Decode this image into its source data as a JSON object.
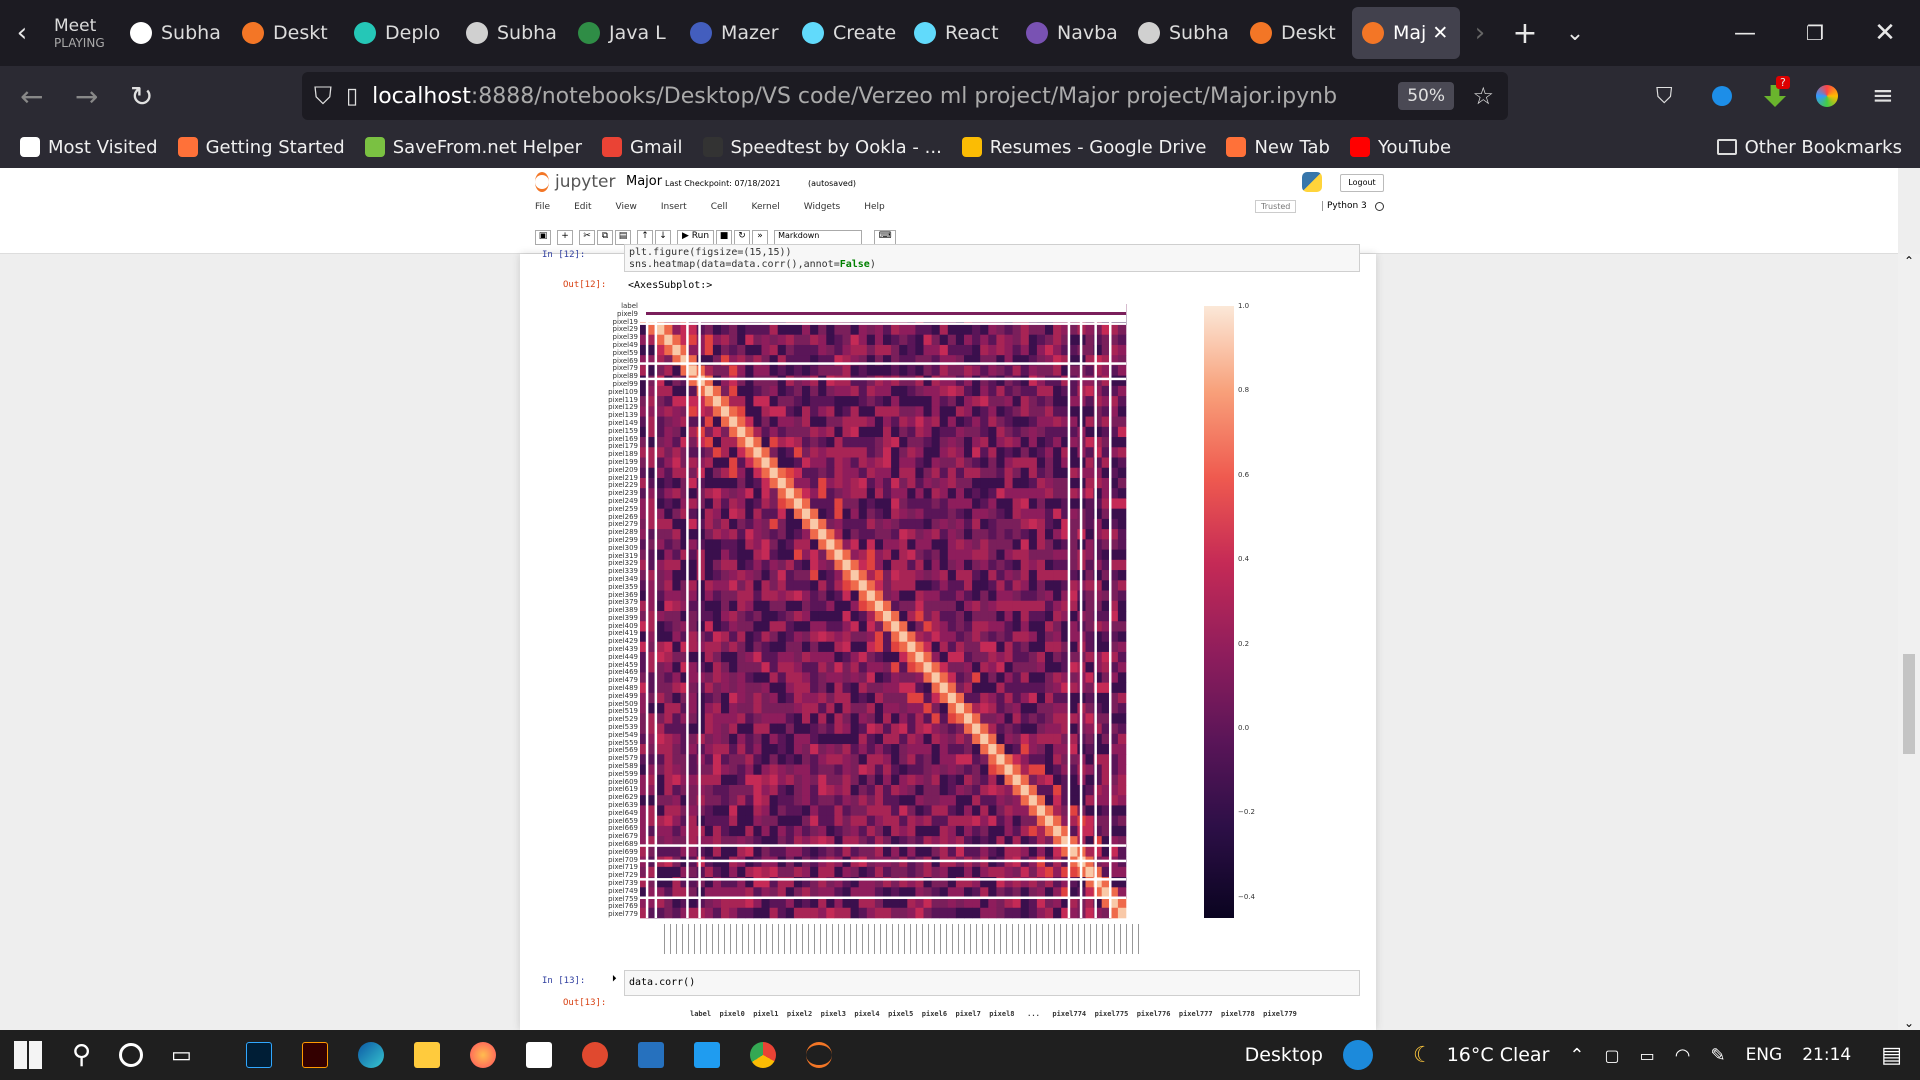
{
  "tabs": [
    {
      "label": "Meet",
      "sub": "PLAYING",
      "icon": "meet-icon"
    },
    {
      "label": "Subha",
      "icon": "github-icon",
      "color": "#ffffff"
    },
    {
      "label": "Deskt",
      "icon": "jupyter-icon",
      "color": "#f37626"
    },
    {
      "label": "Deplo",
      "icon": "netlify-icon",
      "color": "#25c7b7"
    },
    {
      "label": "Subha",
      "icon": "alien-icon",
      "color": "#d0d0d0"
    },
    {
      "label": "Java L",
      "icon": "java-icon",
      "color": "#2f8d46"
    },
    {
      "label": "Mazer",
      "icon": "mazer-icon",
      "color": "#435ebe"
    },
    {
      "label": "Create",
      "icon": "react-icon",
      "color": "#61dafb"
    },
    {
      "label": "React",
      "icon": "react-icon",
      "color": "#61dafb"
    },
    {
      "label": "Navba",
      "icon": "bootstrap-icon",
      "color": "#7952b3"
    },
    {
      "label": "Subha",
      "icon": "alien-icon",
      "color": "#d0d0d0"
    },
    {
      "label": "Deskt",
      "icon": "jupyter-icon",
      "color": "#f37626"
    },
    {
      "label": "Maj",
      "icon": "notebook-icon",
      "color": "#f37626",
      "active": true
    }
  ],
  "url": {
    "host": "localhost",
    "path": ":8888/notebooks/Desktop/VS code/Verzeo ml project/Major project/Major.ipynb",
    "zoom": "50%"
  },
  "bookmarks": [
    {
      "label": "Most Visited",
      "icon": "gear-icon",
      "color": "#ffffff"
    },
    {
      "label": "Getting Started",
      "icon": "firefox-icon",
      "color": "#ff7139"
    },
    {
      "label": "SaveFrom.net Helper",
      "icon": "download-icon",
      "color": "#7ac142"
    },
    {
      "label": "Gmail",
      "icon": "gmail-icon",
      "color": "#ea4335"
    },
    {
      "label": "Speedtest by Ookla - ...",
      "icon": "speedtest-icon",
      "color": "#333333"
    },
    {
      "label": "Resumes - Google Drive",
      "icon": "drive-icon",
      "color": "#fbbc04"
    },
    {
      "label": "New Tab",
      "icon": "firefox-icon",
      "color": "#ff7139"
    },
    {
      "label": "YouTube",
      "icon": "youtube-icon",
      "color": "#ff0000"
    }
  ],
  "other_bookmarks": "Other Bookmarks",
  "jupyter": {
    "logo": "jupyter",
    "name": "Major",
    "checkpoint": "Last Checkpoint: 07/18/2021",
    "autosaved": "(autosaved)",
    "logout": "Logout",
    "menu": [
      "File",
      "Edit",
      "View",
      "Insert",
      "Cell",
      "Kernel",
      "Widgets",
      "Help"
    ],
    "trusted": "Trusted",
    "kernel": "Python 3",
    "run": "Run",
    "cell_type": "Markdown"
  },
  "cells": {
    "in12_prompt": "In [12]:",
    "in12_line1": "plt.figure(figsize=(15,15))",
    "in12_line2_a": "sns.heatmap(data=data.corr(),annot=",
    "in12_line2_b": "False",
    "in12_line2_c": ")",
    "out12_prompt": "Out[12]:",
    "out12_text": "<AxesSubplot:>",
    "in13_prompt": "In [13]:",
    "in13_code": "data.corr()",
    "out13_prompt": "Out[13]:",
    "out13_header": "label  pixel0  pixel1  pixel2  pixel3  pixel4  pixel5  pixel6  pixel7  pixel8   ...   pixel774  pixel775  pixel776  pixel777  pixel778  pixel779"
  },
  "chart_data": {
    "type": "heatmap",
    "title": "",
    "row_labels": [
      "label",
      "pixel9",
      "pixel19",
      "pixel29",
      "pixel39",
      "pixel49",
      "pixel59",
      "pixel69",
      "pixel79",
      "pixel89",
      "pixel99",
      "pixel109",
      "pixel119",
      "pixel129",
      "pixel139",
      "pixel149",
      "pixel159",
      "pixel169",
      "pixel179",
      "pixel189",
      "pixel199",
      "pixel209",
      "pixel219",
      "pixel229",
      "pixel239",
      "pixel249",
      "pixel259",
      "pixel269",
      "pixel279",
      "pixel289",
      "pixel299",
      "pixel309",
      "pixel319",
      "pixel329",
      "pixel339",
      "pixel349",
      "pixel359",
      "pixel369",
      "pixel379",
      "pixel389",
      "pixel399",
      "pixel409",
      "pixel419",
      "pixel429",
      "pixel439",
      "pixel449",
      "pixel459",
      "pixel469",
      "pixel479",
      "pixel489",
      "pixel499",
      "pixel509",
      "pixel519",
      "pixel529",
      "pixel539",
      "pixel549",
      "pixel559",
      "pixel569",
      "pixel579",
      "pixel589",
      "pixel599",
      "pixel609",
      "pixel619",
      "pixel629",
      "pixel639",
      "pixel649",
      "pixel659",
      "pixel669",
      "pixel679",
      "pixel689",
      "pixel699",
      "pixel709",
      "pixel719",
      "pixel729",
      "pixel739",
      "pixel749",
      "pixel759",
      "pixel769",
      "pixel779"
    ],
    "colorbar_ticks": [
      "1.0",
      "0.8",
      "0.6",
      "0.4",
      "0.2",
      "0.0",
      "−0.2",
      "−0.4"
    ],
    "colorbar_range": [
      -0.45,
      1.0
    ],
    "diagonal_value": 1.0,
    "background_value": 0.0,
    "colors": {
      "low": "#0a0420",
      "mid": "#7a1f5b",
      "high": "#fbe8d8"
    }
  },
  "taskbar": {
    "desktop": "Desktop",
    "weather": "16°C Clear",
    "lang": "ENG",
    "time": "21:14"
  }
}
